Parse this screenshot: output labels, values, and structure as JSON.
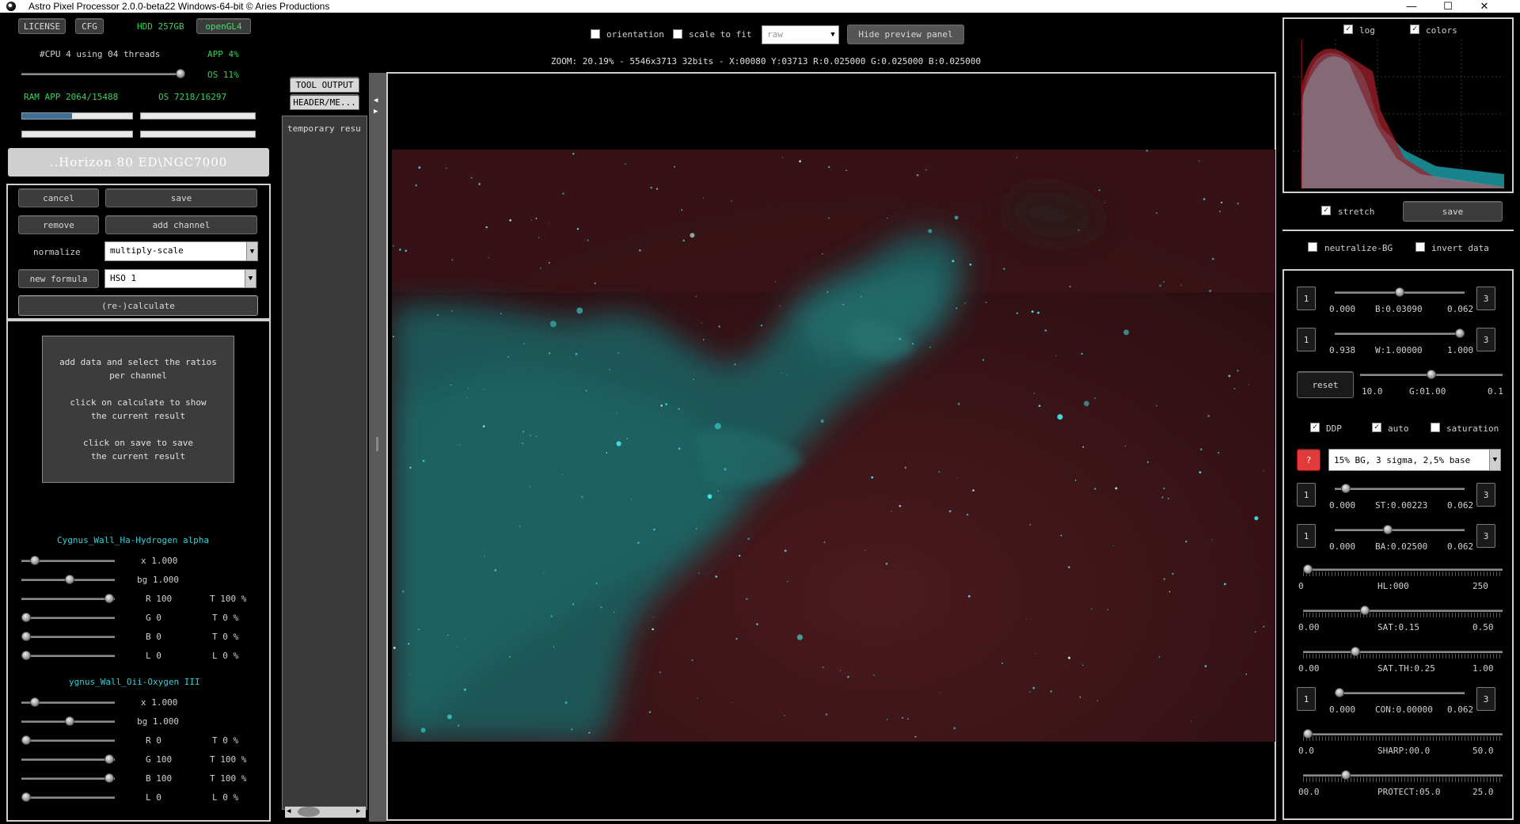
{
  "window": {
    "title": "Astro Pixel Processor 2.0.0-beta22 Windows-64-bit © Aries Productions",
    "minimize": "—",
    "maximize": "☐",
    "close": "✕"
  },
  "status": {
    "license": "LICENSE",
    "cfg": "CFG",
    "hdd": "HDD 257GB",
    "opengl": "openGL4",
    "cpu": "#CPU 4  using 04 threads",
    "app_cpu": "APP 4%",
    "os_cpu": "OS 11%",
    "ram": "RAM  APP 2064/15488",
    "ram_os": "OS 7218/16297",
    "threads_level": 1.0,
    "ram_app_level": 0.45
  },
  "path": "..Horizon 80 ED\\NGC7000",
  "left": {
    "cancel": "cancel",
    "save": "save",
    "remove": "remove",
    "add_channel": "add channel",
    "normalize_label": "normalize",
    "normalize_value": "multiply-scale",
    "new_formula": "new formula",
    "formula_value": "HSO 1",
    "recalculate": "(re-)calculate",
    "help_text": "add data and select the ratios\nper channel\n\nclick on calculate to show\nthe current result\n\nclick on save to save\nthe current result",
    "channels": [
      {
        "name": "Cygnus_Wall_Ha-Hydrogen alpha",
        "rows": [
          {
            "label": "x 1.000",
            "t": "",
            "level": 0.1
          },
          {
            "label": "bg 1.000",
            "t": "",
            "level": 0.5
          },
          {
            "label": "R 100",
            "t": "T 100 %",
            "level": 0.95
          },
          {
            "label": "G 0",
            "t": "T 0 %",
            "level": 0.0
          },
          {
            "label": "B 0",
            "t": "T 0 %",
            "level": 0.0
          },
          {
            "label": "L 0",
            "t": "L 0 %",
            "level": 0.0
          }
        ]
      },
      {
        "name": "ygnus_Wall_Oii-Oxygen III",
        "rows": [
          {
            "label": "x 1.000",
            "t": "",
            "level": 0.1
          },
          {
            "label": "bg 1.000",
            "t": "",
            "level": 0.5
          },
          {
            "label": "R 0",
            "t": "T 0 %",
            "level": 0.0
          },
          {
            "label": "G 100",
            "t": "T 100 %",
            "level": 0.95
          },
          {
            "label": "B 100",
            "t": "T 100 %",
            "level": 0.95
          },
          {
            "label": "L 0",
            "t": "L 0 %",
            "level": 0.0
          }
        ]
      }
    ]
  },
  "middle": {
    "tab_tool_output": "TOOL OUTPUT",
    "tab_header": "HEADER/ME...",
    "temp_result": "temporary resu"
  },
  "top": {
    "orientation": "orientation",
    "scale_to_fit": "scale to fit",
    "raw": "raw",
    "hide_preview": "Hide preview panel",
    "zoom": "ZOOM: 20.19% - 5546x3713 32bits - X:00080 Y:03713 R:0.025000 G:0.025000 B:0.025000"
  },
  "right": {
    "log": "log",
    "colors": "colors",
    "stretch": "stretch",
    "save": "save",
    "neutralize": "neutralize-BG",
    "invert": "invert data",
    "b_row": {
      "l": "1",
      "r": "3",
      "min": "0.000",
      "val": "B:0.03090",
      "max": "0.062",
      "level": 0.5
    },
    "w_row": {
      "l": "1",
      "r": "3",
      "min": "0.938",
      "val": "W:1.00000",
      "max": "1.000",
      "level": 1.0
    },
    "reset": "reset",
    "g_row": {
      "min": "10.0",
      "val": "G:01.00",
      "max": "0.1",
      "level": 0.5
    },
    "ddp": "DDP",
    "auto": "auto",
    "saturation": "saturation",
    "question": "?",
    "preset": "15% BG, 3 sigma, 2,5% base",
    "st_row": {
      "l": "1",
      "r": "3",
      "min": "0.000",
      "val": "ST:0.00223",
      "max": "0.062",
      "level": 0.05
    },
    "ba_row": {
      "l": "1",
      "r": "3",
      "min": "0.000",
      "val": "BA:0.02500",
      "max": "0.062",
      "level": 0.4
    },
    "hl_row": {
      "min": "0",
      "val": "HL:000",
      "max": "250",
      "level": 0.0
    },
    "sat_row": {
      "min": "0.00",
      "val": "SAT:0.15",
      "max": "0.50",
      "level": 0.3
    },
    "satth_row": {
      "min": "0.00",
      "val": "SAT.TH:0.25",
      "max": "1.00",
      "level": 0.25
    },
    "con_row": {
      "l": "1",
      "r": "3",
      "min": "0.000",
      "val": "CON:0.00000",
      "max": "0.062",
      "level": 0.0
    },
    "sharp_row": {
      "min": "0.0",
      "val": "SHARP:00.0",
      "max": "50.0",
      "level": 0.0
    },
    "protect_row": {
      "min": "00.0",
      "val": "PROTECT:05.0",
      "max": "25.0",
      "level": 0.2
    }
  },
  "colors": {
    "green": "#35d15a",
    "cyan": "#2fd2d6",
    "nebula_teal": "#1f6e6e",
    "nebula_red": "#5a1e22"
  }
}
